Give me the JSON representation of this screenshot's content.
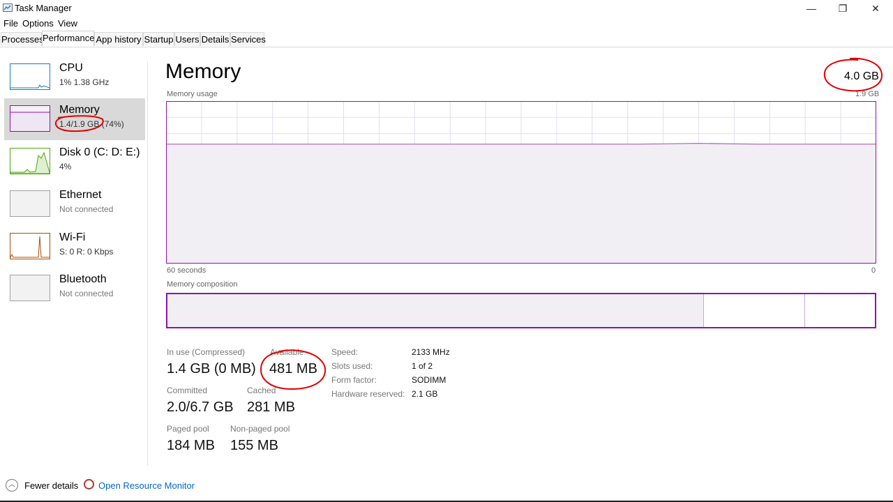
{
  "window": {
    "title": "Task Manager",
    "controls": {
      "minimize": "—",
      "maximize": "❐",
      "close": "✕"
    }
  },
  "menu": [
    "File",
    "Options",
    "View"
  ],
  "tabs": [
    "Processes",
    "Performance",
    "App history",
    "Startup",
    "Users",
    "Details",
    "Services"
  ],
  "active_tab": "Performance",
  "sidebar": {
    "items": [
      {
        "name": "CPU",
        "sub": "1%  1.38 GHz",
        "color": "#117dbb",
        "selected": false
      },
      {
        "name": "Memory",
        "sub": "1.4/1.9 GB (74%)",
        "color": "#8b12ae",
        "selected": true
      },
      {
        "name": "Disk 0 (C: D: E:)",
        "sub": "4%",
        "color": "#4da60c",
        "selected": false
      },
      {
        "name": "Ethernet",
        "sub": "Not connected",
        "color": "#a0a0a0",
        "selected": false
      },
      {
        "name": "Wi-Fi",
        "sub": "S: 0  R: 0 Kbps",
        "color": "#a74f01",
        "selected": false
      },
      {
        "name": "Bluetooth",
        "sub": "Not connected",
        "color": "#a0a0a0",
        "selected": false
      }
    ]
  },
  "main": {
    "title": "Memory",
    "total": "4.0 GB",
    "usage_label": "Memory usage",
    "usage_max": "1.9 GB",
    "time_left": "60 seconds",
    "time_right": "0",
    "composition_label": "Memory composition",
    "stats": {
      "in_use_label": "In use (Compressed)",
      "in_use_value": "1.4 GB (0 MB)",
      "available_label": "Available",
      "available_value": "481 MB",
      "committed_label": "Committed",
      "committed_value": "2.0/6.7 GB",
      "cached_label": "Cached",
      "cached_value": "281 MB",
      "paged_label": "Paged pool",
      "paged_value": "184 MB",
      "nonpaged_label": "Non-paged pool",
      "nonpaged_value": "155 MB"
    },
    "details": {
      "speed_label": "Speed:",
      "speed_value": "2133 MHz",
      "slots_label": "Slots used:",
      "slots_value": "1 of 2",
      "form_label": "Form factor:",
      "form_value": "SODIMM",
      "hwres_label": "Hardware reserved:",
      "hwres_value": "2.1 GB"
    }
  },
  "chart_data": {
    "type": "line",
    "xlabel": "60 seconds",
    "ylim": [
      0,
      1.9
    ],
    "x": [
      60,
      55,
      50,
      45,
      40,
      35,
      30,
      25,
      20,
      15,
      10,
      5,
      0
    ],
    "series": [
      {
        "values": [
          1.4,
          1.4,
          1.4,
          1.4,
          1.4,
          1.4,
          1.4,
          1.4,
          1.4,
          1.41,
          1.4,
          1.4,
          1.4
        ]
      }
    ],
    "composition": {
      "in_use_fraction": 0.757,
      "modified_fraction": 0.143,
      "free_fraction": 0.1
    }
  },
  "footer": {
    "fewer_details": "Fewer details",
    "resource_monitor": "Open Resource Monitor"
  }
}
